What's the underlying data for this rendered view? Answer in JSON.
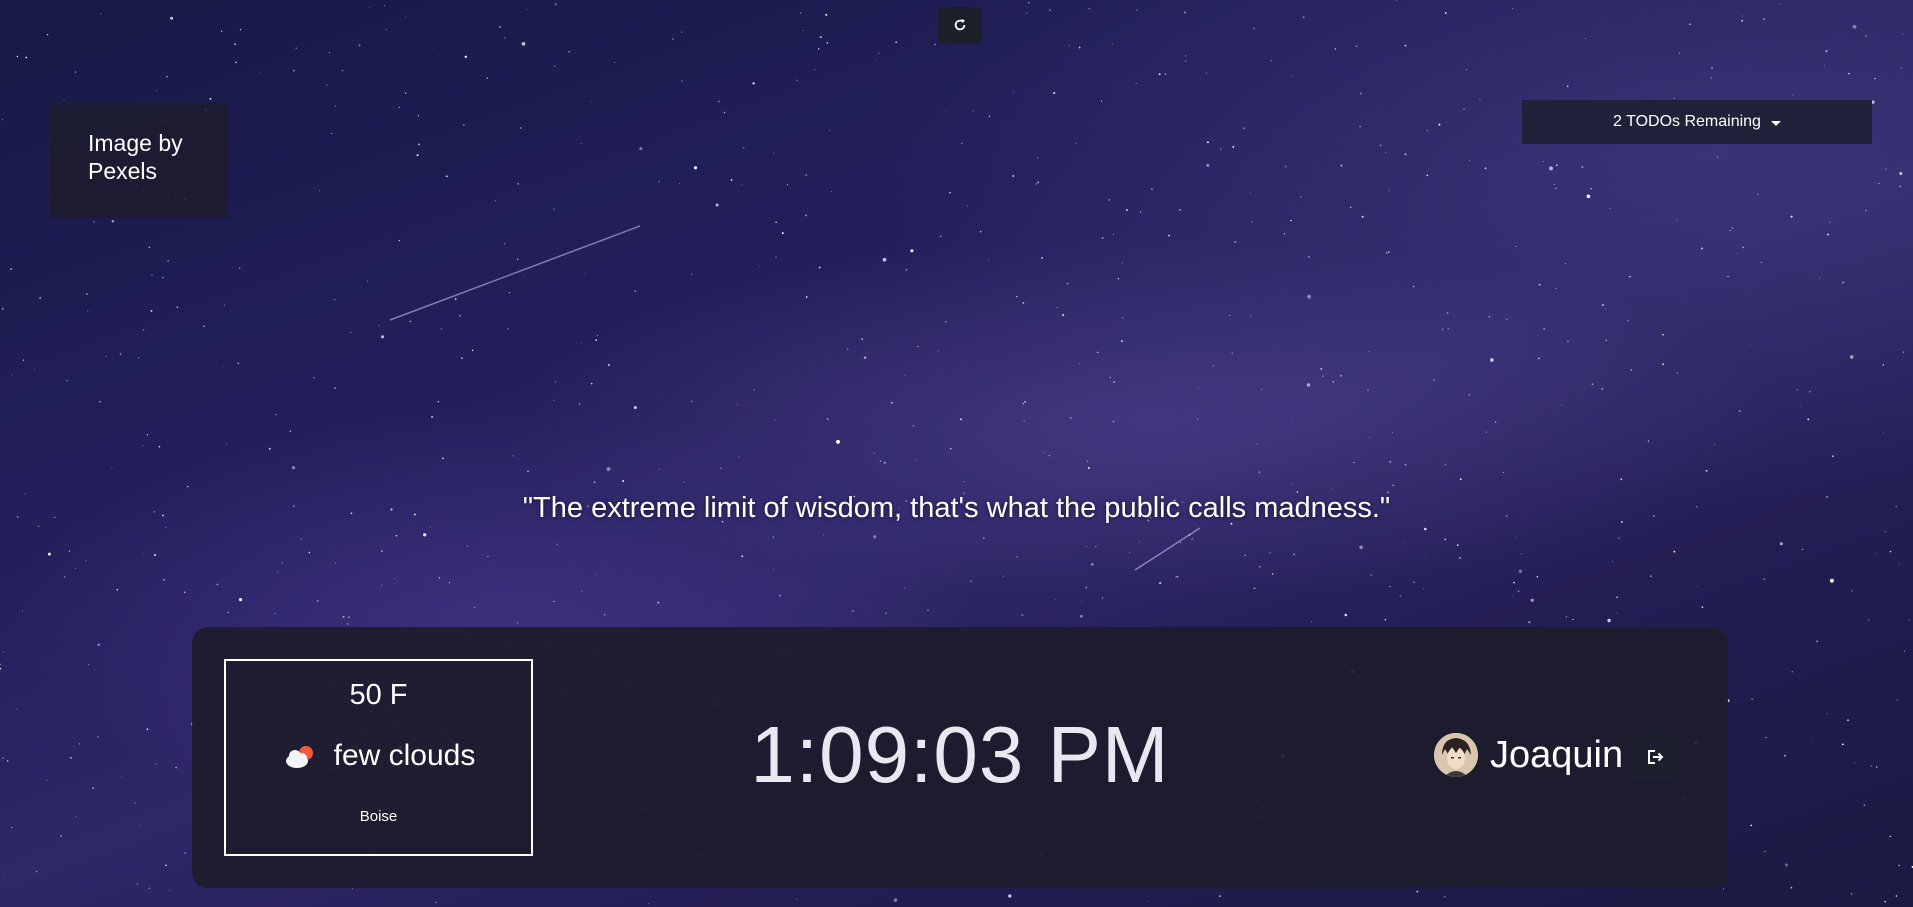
{
  "credit": {
    "text": "Image by Pexels"
  },
  "todos": {
    "label": "2 TODOs Remaining"
  },
  "quote": {
    "text": "\"The extreme limit of wisdom, that's what the public calls madness.\""
  },
  "weather": {
    "temperature": "50 F",
    "condition": "few clouds",
    "city": "Boise",
    "icon": "few-clouds-icon"
  },
  "clock": {
    "time": "1:09:03 PM"
  },
  "user": {
    "name": "Joaquin"
  },
  "icons": {
    "refresh": "refresh-icon",
    "logout": "logout-icon",
    "caret": "caret-down-icon"
  },
  "colors": {
    "panel_bg": "#1d1c2c",
    "button_bg": "#1b1f2a",
    "todo_bg": "#20223a",
    "text": "#ffffff"
  }
}
